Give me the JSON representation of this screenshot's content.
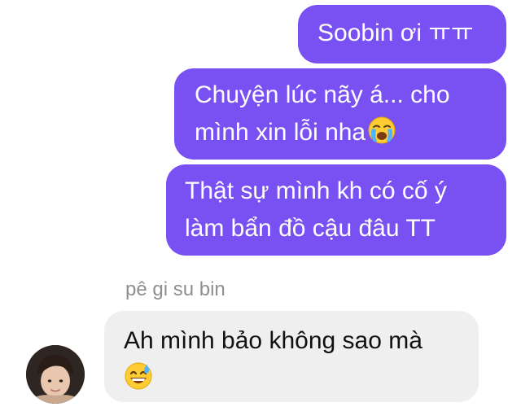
{
  "messages": {
    "m1": {
      "line1": "Soobin ơi ㅠㅠ"
    },
    "m2": {
      "line1": "Chuyện lúc nãy á... cho",
      "line2": "mình xin lỗi nha",
      "emoji": "loudly-crying-face-emoji"
    },
    "m3": {
      "line1": "Thật sự mình kh có cố ý",
      "line2": "làm bẩn đồ cậu đâu TT"
    },
    "m4": {
      "line1": "Ah mình bảo không sao mà",
      "emoji": "grinning-face-with-sweat-emoji"
    }
  },
  "sender": {
    "name": "pê gi su bin"
  },
  "colors": {
    "outgoing_bubble": "#7950f2",
    "incoming_bubble": "#efeff0",
    "sender_name": "#8e8e93"
  }
}
